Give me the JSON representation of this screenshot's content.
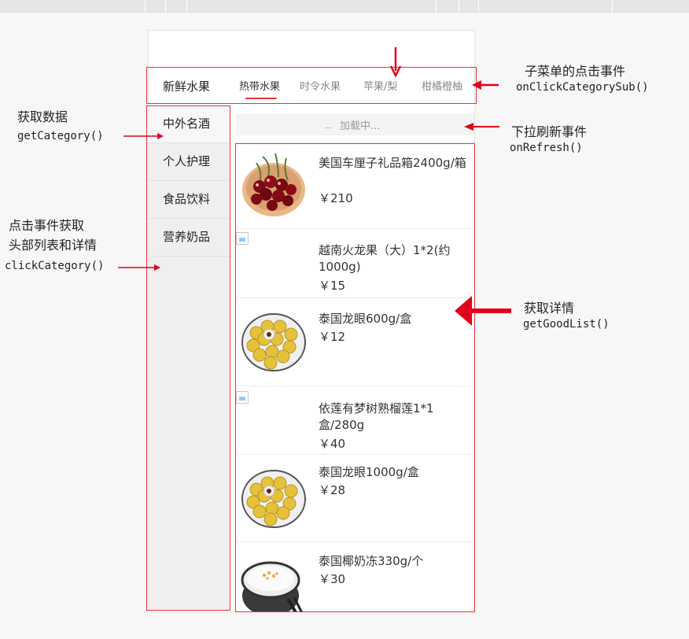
{
  "top_tabs": {
    "main": "新鲜水果",
    "subs": [
      "热带水果",
      "时令水果",
      "苹果/梨",
      "柑橘橙柚"
    ]
  },
  "sidebar": {
    "items": [
      "中外名酒",
      "个人护理",
      "食品饮料",
      "营养奶品"
    ]
  },
  "loading": {
    "icon": "spinner-icon",
    "text": "加载中..."
  },
  "goods": [
    {
      "name": "美国车厘子礼品箱2400g/箱",
      "price": "￥210",
      "image": "cherries"
    },
    {
      "name": "越南火龙果（大）1*2(约1000g)",
      "price": "￥15",
      "image": "broken"
    },
    {
      "name": "泰国龙眼600g/盒",
      "price": "￥12",
      "image": "longan"
    },
    {
      "name": "依莲有梦树熟榴莲1*1盒/280g",
      "price": "￥40",
      "image": "broken"
    },
    {
      "name": "泰国龙眼1000g/盒",
      "price": "￥28",
      "image": "longan"
    },
    {
      "name": "泰国椰奶冻330g/个",
      "price": "￥30",
      "image": "coconut"
    }
  ],
  "annotations": {
    "sub_menu": {
      "label": "子菜单的点击事件",
      "code": "onClickCategorySub()"
    },
    "get_data": {
      "label": "获取数据",
      "code": "getCategory()"
    },
    "refresh": {
      "label": "下拉刷新事件",
      "code": "onRefresh()"
    },
    "click_category": {
      "label_line1": "点击事件获取",
      "label_line2": "头部列表和详情",
      "code": "clickCategory()"
    },
    "detail": {
      "label": "获取详情",
      "code": "getGoodList()"
    }
  },
  "colors": {
    "accent": "#e8323c",
    "annotation_red": "#e0001b"
  }
}
